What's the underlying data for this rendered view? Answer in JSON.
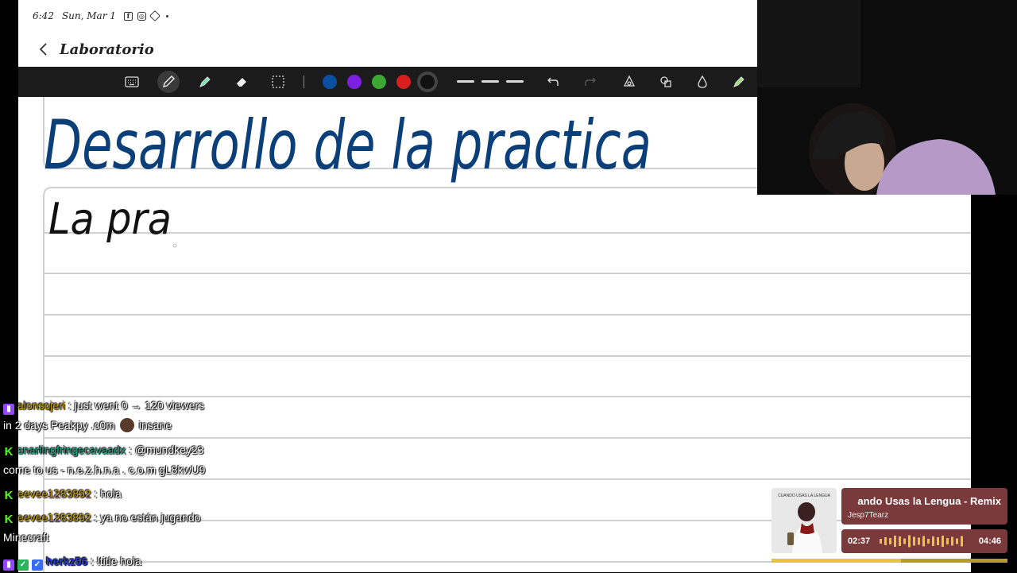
{
  "status_bar": {
    "time": "6:42",
    "date": "Sun, Mar 1"
  },
  "note": {
    "title": "Laboratorio"
  },
  "toolbar": {
    "tools": [
      "keyboard-icon",
      "pen-icon",
      "highlighter-icon",
      "eraser-icon",
      "lasso-select-icon",
      "undo-icon",
      "redo-icon",
      "shape-pen-icon",
      "shapes-icon",
      "ink-icon",
      "ruler-pen-icon"
    ],
    "colors": [
      "#0a4fa0",
      "#7b1fe0",
      "#3aa832",
      "#d81e1e",
      "#111111"
    ],
    "selected_color": "#111111"
  },
  "handwriting": {
    "heading": "Desarrollo de la practica",
    "line1": "La pra"
  },
  "chat": [
    {
      "user": "alonsojeri",
      "msg": ": just went 0 → 120 viewers",
      "cont": "in 2 days Peakpy .c0m",
      "cont2": "insane",
      "color": "#c8a000"
    },
    {
      "user": "snarlingfringecavaadx",
      "msg": ": @mundkey23",
      "cont": "come to us - n.e.z.h.n.a . c.o.m gL8kwU9",
      "color": "#1ea883"
    },
    {
      "user": "eevee1283892",
      "msg": ": hola",
      "color": "#c8a000"
    },
    {
      "user": "eevee1283892",
      "msg": ": ya no están jugando",
      "cont": "Minecraft",
      "color": "#c8a000"
    },
    {
      "user": "herkz56",
      "msg": ": !title hola",
      "color": "#2a3fd0"
    }
  ],
  "now_playing": {
    "album_text": "CUANDO USAS LA LENGUA",
    "song": "ando Usas la Lengua - Remix",
    "artist": "Jesp7Tearz",
    "current": "02:37",
    "total": "04:46",
    "progress": 0.55
  }
}
